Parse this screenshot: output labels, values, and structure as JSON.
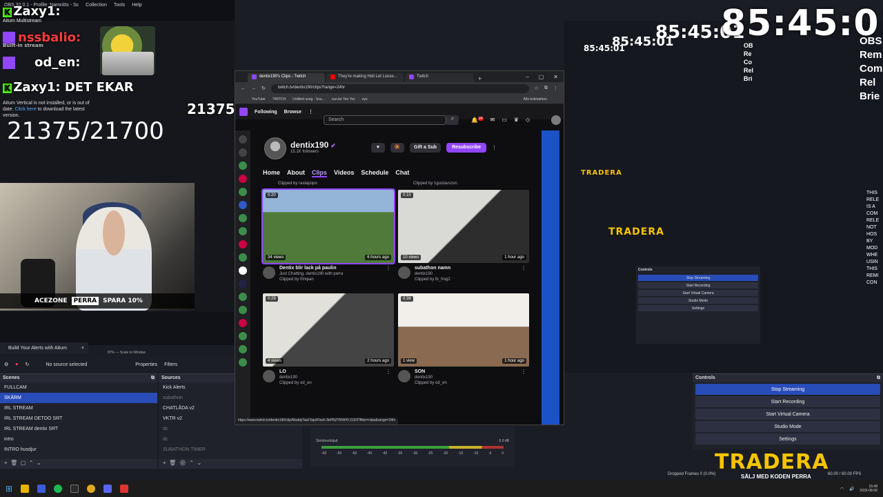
{
  "obs_menu": [
    "OBS 32.0.1 - Profile: Namnlös - Sc",
    "Collection",
    "Tools",
    "Help"
  ],
  "overlay": {
    "chat_user1": "Zaxy1:",
    "chat_user2": "nssbalio:",
    "chat_user3": "od_en:",
    "chat_line4": "Zaxy1: DET EKAR",
    "multistream": "Aitum Multistream",
    "built_in": "Built-in stream",
    "update_text": "Aitum Vertical is not installed, or is out of date.",
    "update_link": "Click here",
    "update_rest": "to download the latest version.",
    "goal_counter": "21375/21700",
    "goal_counter_small": "21375",
    "sponsor_brand": "ACEZONE",
    "sponsor_code": "PERRA",
    "sponsor_offer": "SPARA 10%"
  },
  "timer": {
    "main": "85:45:01"
  },
  "right_text": {
    "col1": [
      "OBS",
      "Rem",
      "Com",
      "Rel",
      "Brie"
    ],
    "col2": [
      "OB",
      "Re",
      "Co",
      "Rel",
      "Bri"
    ],
    "col3": [
      "THIS",
      "RELE",
      "IS A",
      "COM",
      "RELE",
      "NOT",
      "HOS",
      "BY",
      "MOD",
      "WHE",
      "USIN",
      "THIS",
      "REMI",
      "CON"
    ]
  },
  "tradera": {
    "logo": "TRADERA",
    "subline": "SÄLJ MED KODEN PERRA"
  },
  "alerts_box": {
    "label": "Build Your Alerts with Aitum",
    "close": "×"
  },
  "source_status": "No source selected",
  "properties_label": "Properties",
  "filters_label": "Filters",
  "scale_label": "Scale to Window",
  "zoom_label": "87%",
  "scenes": {
    "title": "Scenes",
    "items": [
      "FULLCAM",
      "SKÄRM",
      "IRL STREAM",
      "IRL STREAM DETOO SRT",
      "IRL STREAM dentix SRT",
      "intro",
      "INTRO husdjur"
    ],
    "selected_index": 1
  },
  "sources": {
    "title": "Sources",
    "items": [
      "Kick Alerts",
      "subathon",
      "CHATLÅDA v2",
      "VKTR v2",
      "dc",
      "dc",
      "SUBATHON TIMER"
    ]
  },
  "controls": {
    "title": "Controls",
    "buttons": [
      "Stop Streaming",
      "Start Recording",
      "Start Virtual Camera",
      "Studio Mode",
      "Settings"
    ],
    "active_index": 0
  },
  "mixer": {
    "label": "Skrivbordsljud",
    "db": "0.0 dB",
    "ticks": [
      "-60",
      "-55",
      "-50",
      "-45",
      "-40",
      "-35",
      "-30",
      "-25",
      "-20",
      "-15",
      "-10",
      "-5",
      "0"
    ]
  },
  "browser": {
    "tabs": [
      {
        "label": "dentix190's Clips - Twitch",
        "kind": "twitch",
        "active": true
      },
      {
        "label": "They're making Hell Let Loose...",
        "kind": "yt",
        "active": false
      },
      {
        "label": "Twitch",
        "kind": "twitch",
        "active": false
      }
    ],
    "new_tab": "+",
    "url": "twitch.tv/dentix190/clips?range=24hr",
    "bookmarks": [
      "YouTube",
      "TWITCH",
      "Untitled song - Sou...",
      "sun.be Yes Yes",
      "eye"
    ],
    "bookmarks_right": "Alla bokmärken",
    "status_url": "https://www.twitch.tv/dentix190/clip/MuddyTackTapirFloof-JlePNZYRW4YJ13Xf?filter=clips&range=24hr"
  },
  "twitch": {
    "nav_following": "Following",
    "nav_browse": "Browse",
    "search_placeholder": "Search",
    "notif_count": "24",
    "channel_name": "dentix190",
    "followers": "15.1K followers",
    "gift_label": "Gift a Sub",
    "resub_label": "Resubscribe",
    "tabs": [
      "Home",
      "About",
      "Clips",
      "Videos",
      "Schedule",
      "Chat"
    ],
    "active_tab": "Clips",
    "prev_clippers": [
      "Clipped by rastapopo",
      "Clipped by 1gustavszon"
    ],
    "clips": [
      {
        "duration": "0:20",
        "views": "34 views",
        "ago": "6 hours ago",
        "title": "Dentix blir lack på paulin",
        "line2": "Just Chatting, dentix190 with perra",
        "line3": "Clipped by l0mpan"
      },
      {
        "duration": "0:10",
        "views": "10 views",
        "ago": "1 hour ago",
        "title": "subathon namn",
        "line2": "dentix190",
        "line3": "Clipped by lb_frog2"
      },
      {
        "duration": "0:29",
        "views": "4 views",
        "ago": "2 hours ago",
        "title": "LO",
        "line2": "dentix190",
        "line3": "Clipped by od_en"
      },
      {
        "duration": "0:39",
        "views": "1 view",
        "ago": "1 hour ago",
        "title": "SON",
        "line2": "dentix190",
        "line3": "Clipped by od_en"
      }
    ]
  },
  "status_bar": {
    "dropped": "Dropped Frames 0 (0.0%)",
    "fps": "60.00 / 60.00 FPS"
  },
  "taskbar": {
    "time": "15:48",
    "date": "2026-08-06"
  },
  "colors": {
    "twitch_purple": "#9146ff",
    "obs_select": "#284cb8",
    "tradera_yellow": "#f5c400",
    "kick_green": "#53fc18"
  }
}
